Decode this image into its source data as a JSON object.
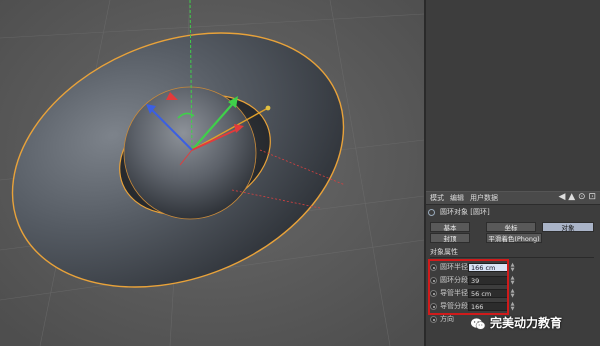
{
  "panel": {
    "tabs": [
      "模式",
      "编辑",
      "用户数据"
    ],
    "object_title": "圆环对象 [圆环]",
    "attr_tabs_row1": [
      "基本",
      "坐标",
      "对象"
    ],
    "attr_tabs_row2": [
      "封顶",
      "平滑着色(Phong)"
    ],
    "active_tab": "对象",
    "section_title": "对象属性",
    "properties": [
      {
        "label": "圆环半径",
        "value": "166 cm",
        "editing": true
      },
      {
        "label": "圆环分段",
        "value": "39",
        "editing": false
      },
      {
        "label": "导管半径",
        "value": "56 cm",
        "editing": false
      },
      {
        "label": "导管分段",
        "value": "166",
        "editing": false
      },
      {
        "label": "方向",
        "value": "",
        "editing": false
      }
    ],
    "highlight_color": "#d01b1b"
  },
  "viewport": {
    "background_color": "#5a5a5a",
    "torus_color": "#4a5058",
    "selection_outline_color": "#e8a23a",
    "axis_colors": {
      "x": "#e23b3b",
      "y": "#3fd04a",
      "z": "#3b5fe2"
    }
  },
  "watermark": {
    "text": "完美动力教育",
    "icon": "wechat-logo"
  }
}
